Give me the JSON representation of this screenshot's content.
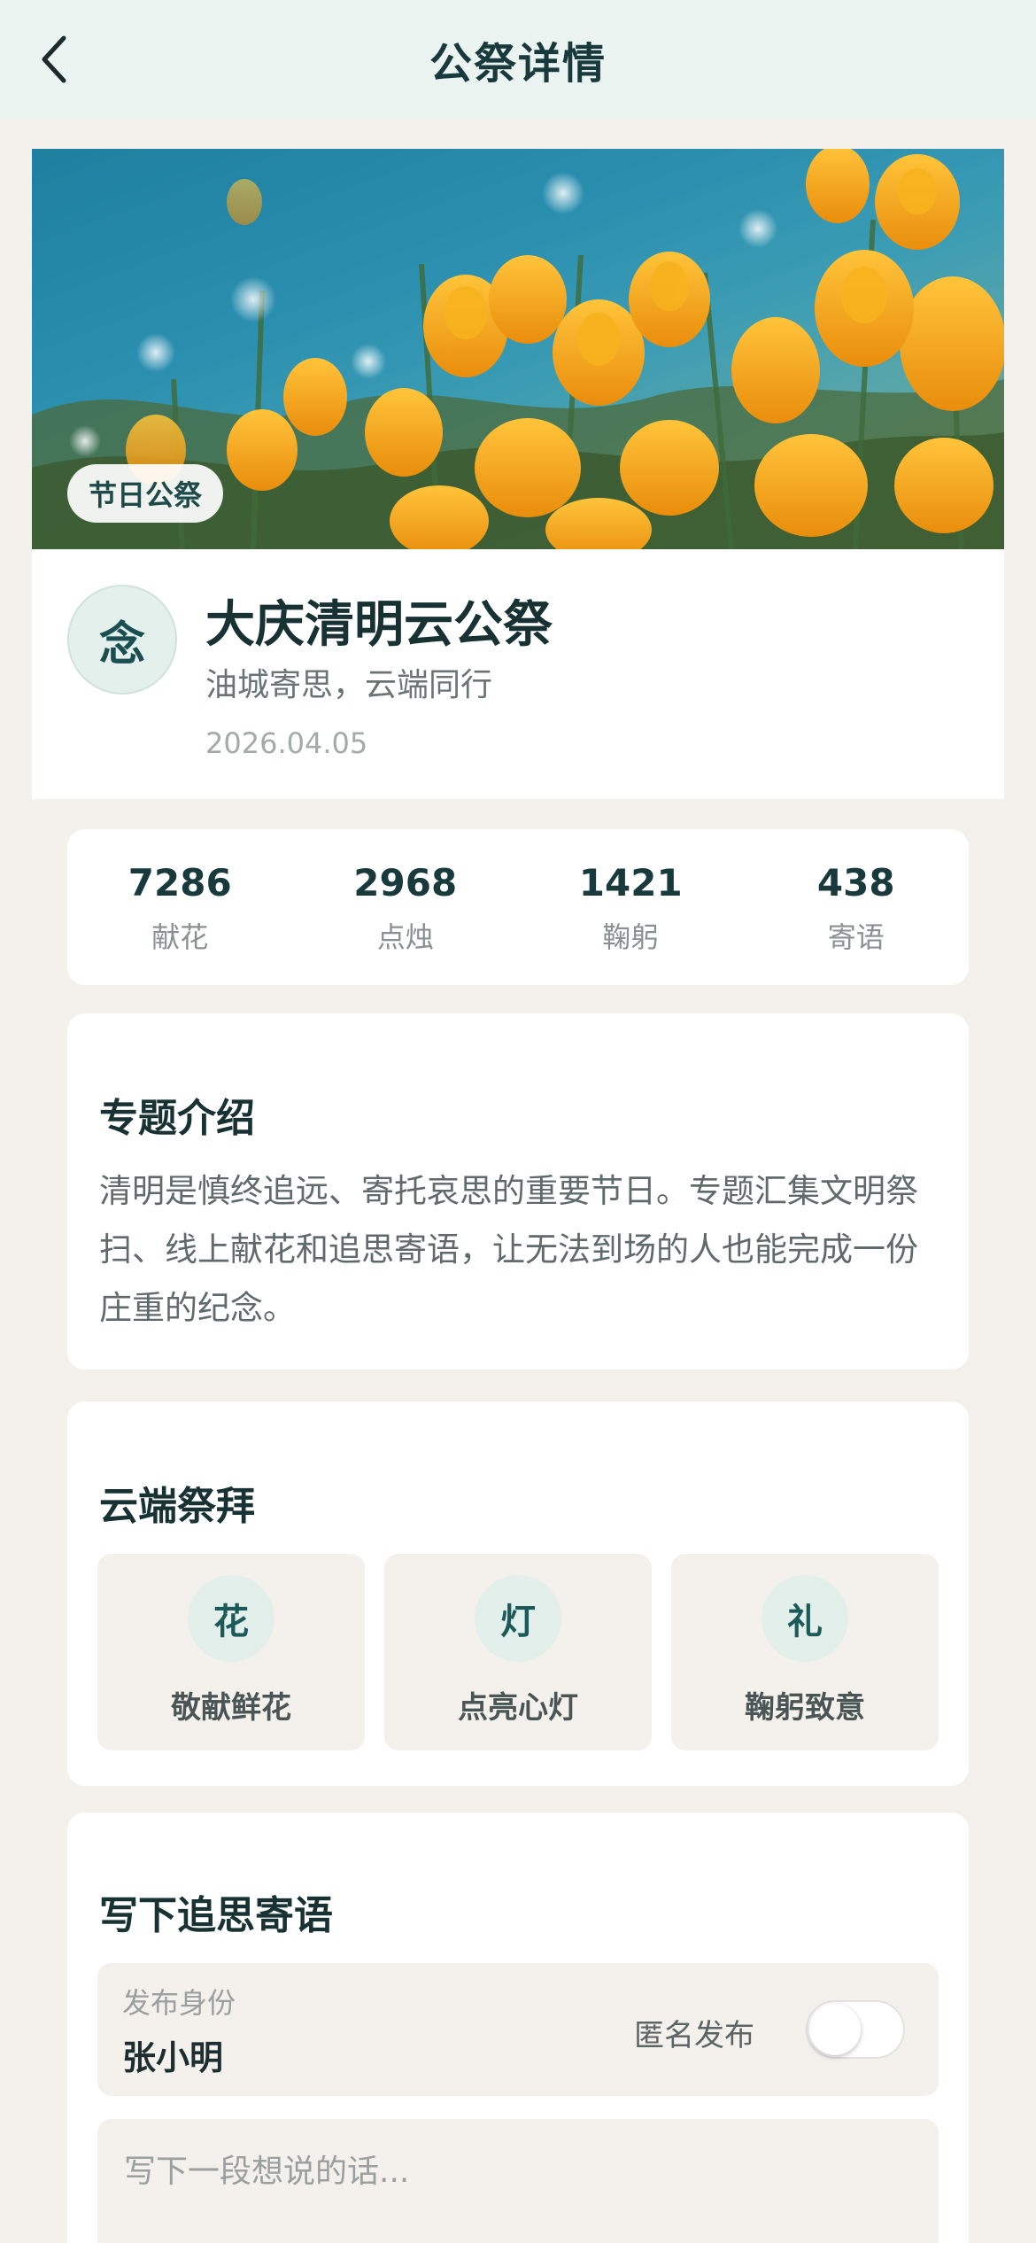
{
  "nav": {
    "title": "公祭详情"
  },
  "hero": {
    "tag": "节日公祭"
  },
  "info": {
    "avatar_char": "念",
    "name": "大庆清明云公祭",
    "slogan": "油城寄思，云端同行",
    "date": "2026.04.05"
  },
  "stats": [
    {
      "value": "7286",
      "label": "献花"
    },
    {
      "value": "2968",
      "label": "点烛"
    },
    {
      "value": "1421",
      "label": "鞠躬"
    },
    {
      "value": "438",
      "label": "寄语"
    }
  ],
  "intro": {
    "title": "专题介绍",
    "text": "清明是慎终追远、寄托哀思的重要节日。专题汇集文明祭扫、线上献花和追思寄语，让无法到场的人也能完成一份庄重的纪念。"
  },
  "worship": {
    "title": "云端祭拜",
    "actions": [
      {
        "icon_char": "花",
        "label": "敬献鲜花"
      },
      {
        "icon_char": "灯",
        "label": "点亮心灯"
      },
      {
        "icon_char": "礼",
        "label": "鞠躬致意"
      }
    ]
  },
  "message": {
    "title": "写下追思寄语",
    "identity_label": "发布身份",
    "identity_name": "张小明",
    "anonymous_label": "匿名发布",
    "anonymous_on": false,
    "placeholder": "写下一段想说的话..."
  },
  "colors": {
    "background": "#f4f1ec",
    "nav_background": "#ecf4f1",
    "accent": "#1c5a5a",
    "icon_circle": "#e3efeb"
  },
  "icons": {
    "back": "chevron-left-icon"
  }
}
